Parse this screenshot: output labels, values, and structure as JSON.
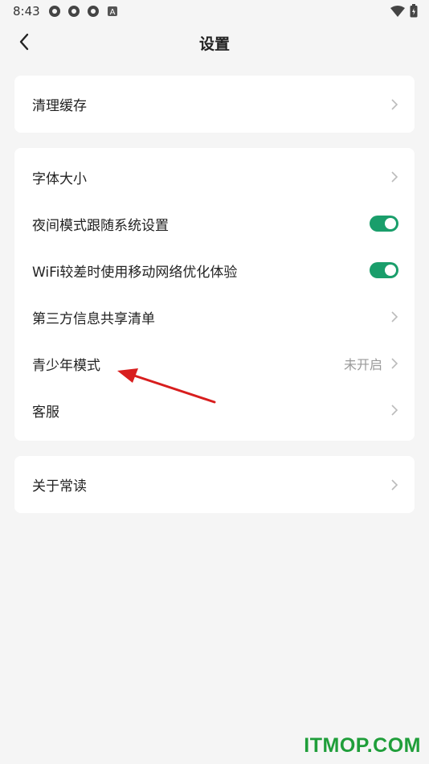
{
  "status_bar": {
    "time": "8:43",
    "left_icons": [
      "notification-icon",
      "notification-icon",
      "notification-icon",
      "a-letter-icon"
    ],
    "right_icons": [
      "wifi-icon",
      "battery-icon"
    ]
  },
  "header": {
    "title": "设置",
    "back_icon": "back-arrow-icon"
  },
  "groups": [
    {
      "items": [
        {
          "label": "清理缓存",
          "control": "chevron"
        }
      ]
    },
    {
      "items": [
        {
          "label": "字体大小",
          "control": "chevron"
        },
        {
          "label": "夜间模式跟随系统设置",
          "control": "toggle",
          "state": "on"
        },
        {
          "label": "WiFi较差时使用移动网络优化体验",
          "control": "toggle",
          "state": "on"
        },
        {
          "label": "第三方信息共享清单",
          "control": "chevron"
        },
        {
          "label": "青少年模式",
          "value": "未开启",
          "control": "chevron"
        },
        {
          "label": "客服",
          "control": "chevron"
        }
      ]
    },
    {
      "items": [
        {
          "label": "关于常读",
          "control": "chevron"
        }
      ]
    }
  ],
  "colors": {
    "background": "#f5f5f5",
    "card": "#ffffff",
    "toggle_on": "#1a9e6b",
    "annotation_arrow": "#d81e1e",
    "watermark": "#1f9e3a"
  },
  "watermark": "ITMOP.COM"
}
